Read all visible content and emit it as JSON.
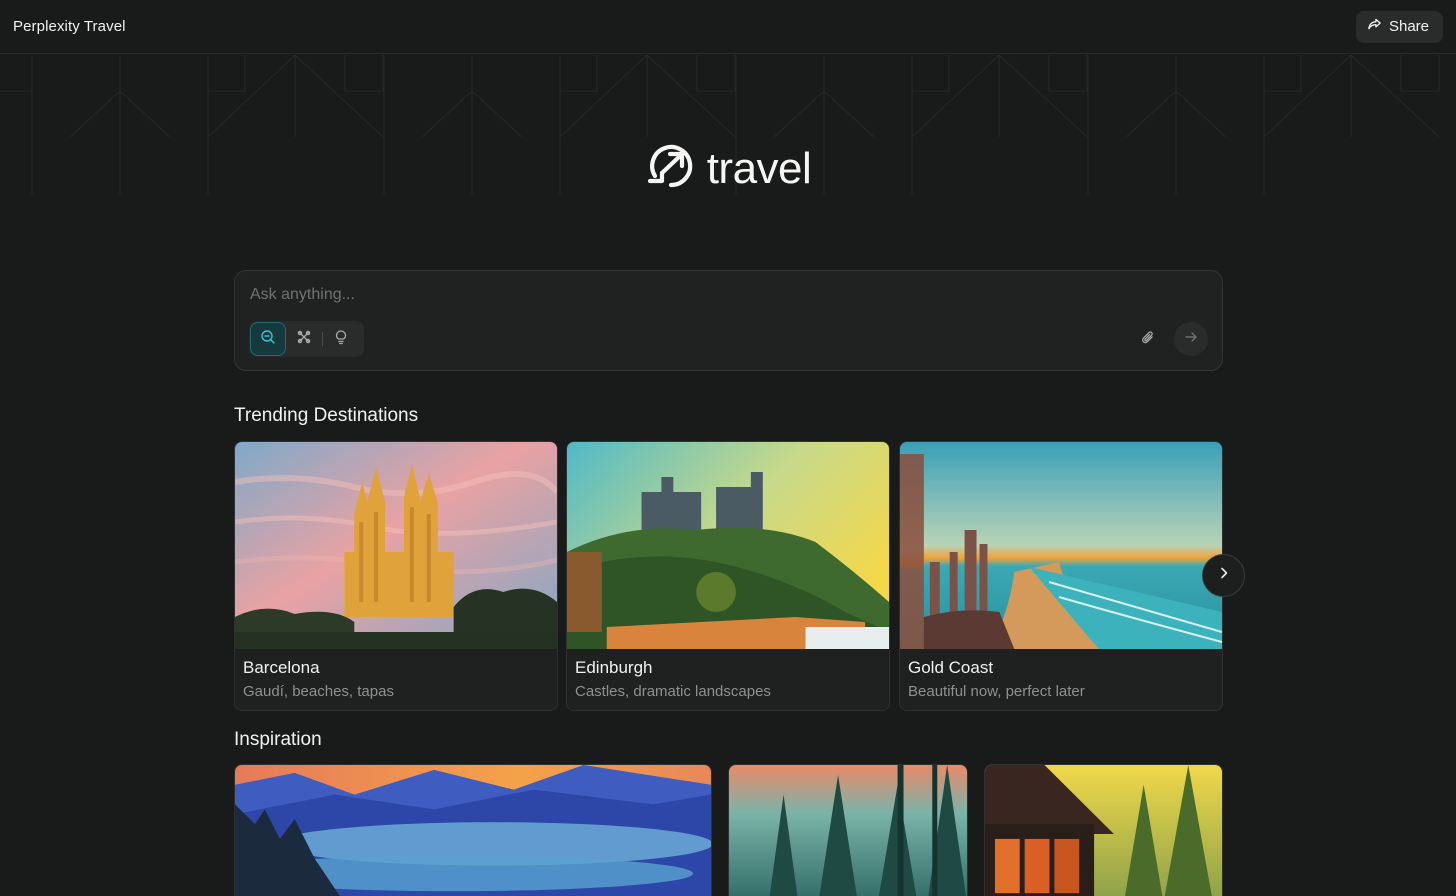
{
  "app": {
    "title": "Perplexity Travel",
    "share_label": "Share",
    "logo_text": "travel"
  },
  "search": {
    "placeholder": "Ask anything..."
  },
  "trending": {
    "title": "Trending Destinations",
    "cards": [
      {
        "name": "Barcelona",
        "desc": "Gaudí, beaches, tapas"
      },
      {
        "name": "Edinburgh",
        "desc": "Castles, dramatic landscapes"
      },
      {
        "name": "Gold Coast",
        "desc": "Beautiful now, perfect later"
      }
    ]
  },
  "inspiration": {
    "title": "Inspiration"
  },
  "colors": {
    "background": "#191a1a",
    "accent": "#1f6b73",
    "card_border": "#2f3131"
  },
  "icons": [
    "share-icon",
    "travel-logo-icon",
    "search-mode-icon",
    "research-mode-icon",
    "idea-mode-icon",
    "paperclip-icon",
    "arrow-right-icon",
    "chevron-right-icon"
  ]
}
